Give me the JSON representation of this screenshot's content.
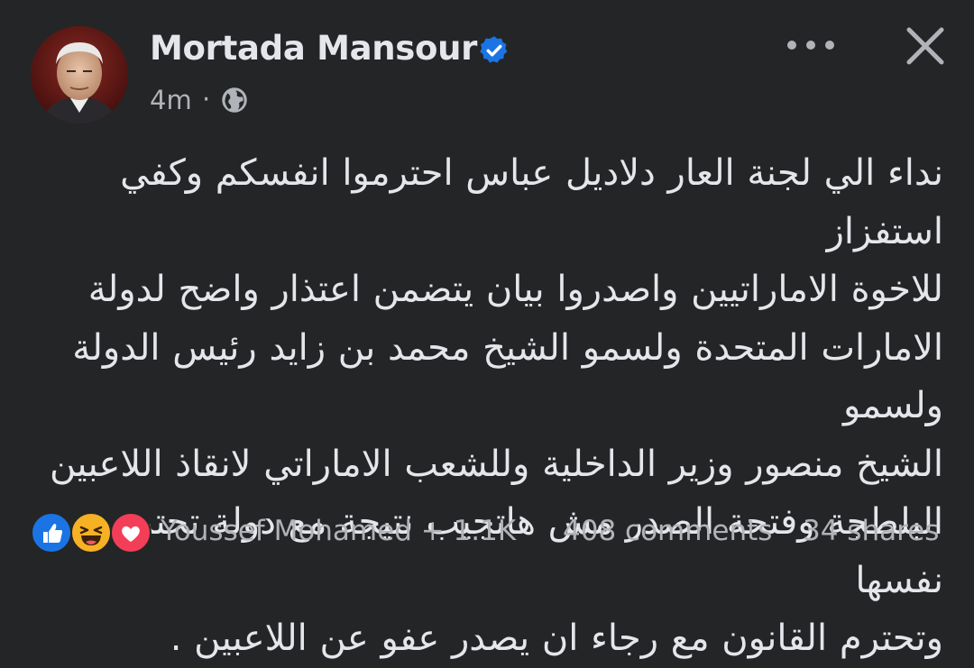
{
  "post": {
    "author": "Mortada Mansour",
    "time": "4m",
    "separator": "·",
    "body": "نداء الي لجنة العار دلاديل عباس احترموا انفسكم وكفي استفزاز\nللاخوة الاماراتيين واصدروا بيان يتضمن اعتذار واضح لدولة\nالامارات المتحدة ولسمو الشيخ محمد بن زايد رئيس الدولة ولسمو\nالشيخ منصور وزير الداخلية وللشعب الاماراتي لانقاذ اللاعبين\nالبلطجة وفتحة الصدر مش هاتجيب نتيجة مع دولة تحترم نفسها\nوتحترم القانون مع رجاء ان يصدر عفو عن اللاعبين ."
  },
  "icons": {
    "verified": "verified-badge-icon",
    "privacy": "globe-icon",
    "more": "more-dots-icon",
    "close": "close-icon",
    "reactions": [
      "like-icon",
      "haha-icon",
      "love-icon"
    ]
  },
  "engagement": {
    "reactions_text": "Youssef Mohamed + 1.1K",
    "comments": "408 comments",
    "shares": "34 shares"
  },
  "colors": {
    "background": "#242526",
    "text": "#e4e6eb",
    "secondary": "#b0b3b8",
    "verified": "#1b74e4",
    "like": "#1b74e4",
    "haha": "#f7b125",
    "love": "#f33e58"
  }
}
